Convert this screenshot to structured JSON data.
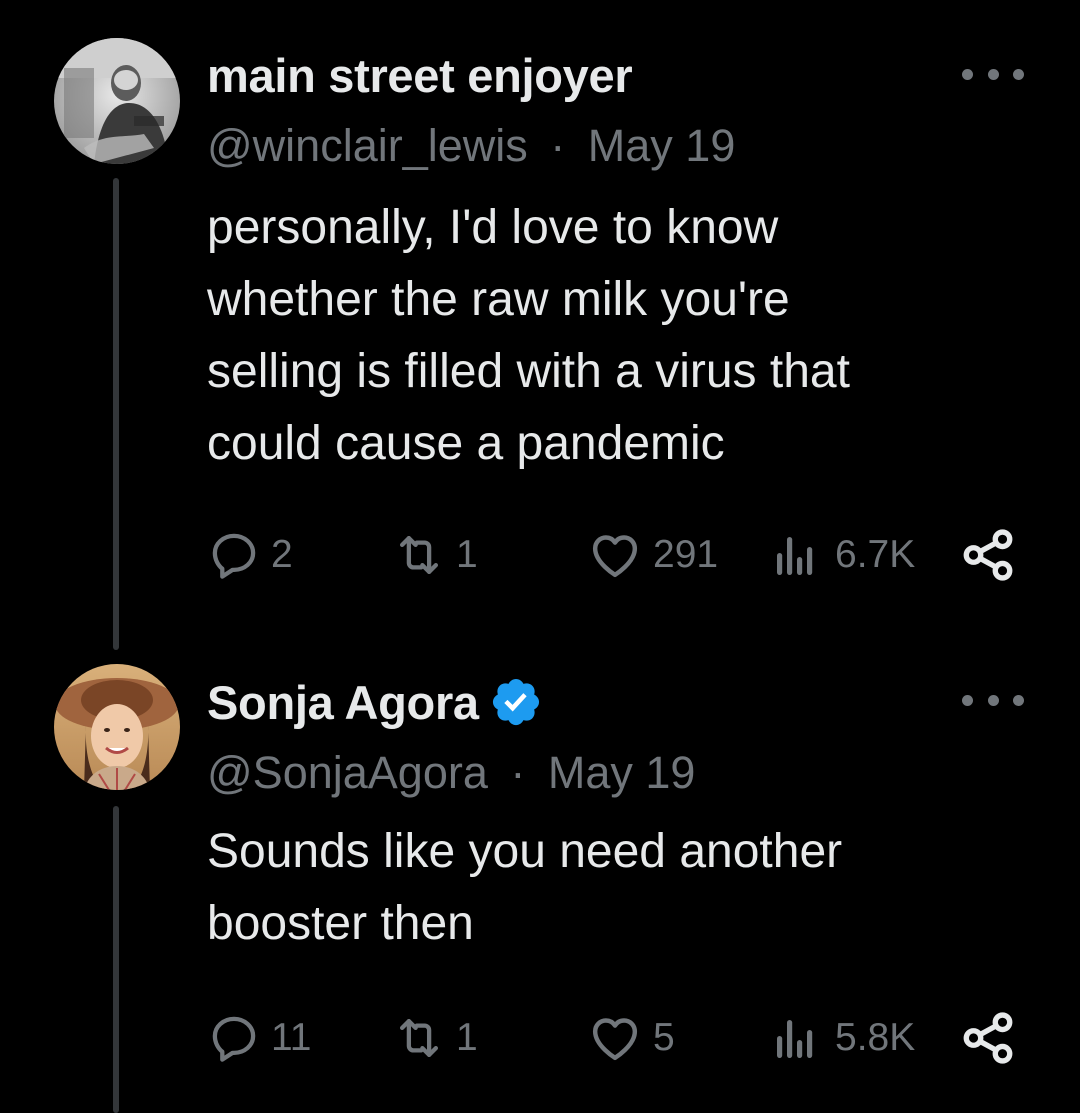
{
  "tweets": [
    {
      "display_name": "main street enjoyer",
      "handle": "@winclair_lewis",
      "separator": "·",
      "date": "May 19",
      "verified": false,
      "body_lines": [
        "personally, I'd love to know",
        "whether the raw milk you're",
        "selling is filled with a virus that",
        "could cause a pandemic"
      ],
      "stats": {
        "replies": "2",
        "reposts": "1",
        "likes": "291",
        "views": "6.7K"
      },
      "avatar": {
        "icon": "vintage-photo-avatar",
        "description_colors": [
          "#d9d9d9",
          "#5a5a5a"
        ]
      }
    },
    {
      "display_name": "Sonja Agora",
      "handle": "@SonjaAgora",
      "separator": "·",
      "date": "May 19",
      "verified": true,
      "body_lines": [
        "Sounds like you need another",
        "booster then"
      ],
      "stats": {
        "replies": "11",
        "reposts": "1",
        "likes": "5",
        "views": "5.8K"
      },
      "avatar": {
        "icon": "woman-in-hat-avatar",
        "description_colors": [
          "#c8935a",
          "#8a5a3c"
        ]
      }
    }
  ],
  "colors": {
    "background": "#000000",
    "primary_text": "#e7e9ea",
    "secondary_text": "#71767b",
    "verified_badge": "#1d9bf0",
    "thread_line": "#333639"
  }
}
